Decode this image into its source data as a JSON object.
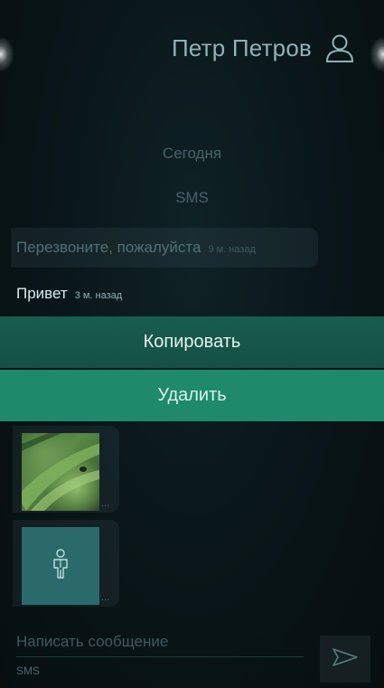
{
  "header": {
    "contact_name": "Петр Петров",
    "icon": "person-icon"
  },
  "conversation": {
    "date_label": "Сегодня",
    "channel_label": "SMS",
    "messages": [
      {
        "text": "Перезвоните, пожалуйста",
        "time": "9 м. назад",
        "direction": "incoming"
      },
      {
        "text": "Привет",
        "time": "3 м. назад",
        "direction": "outgoing"
      }
    ],
    "attachments": [
      {
        "type": "image",
        "more": "..."
      },
      {
        "type": "contact",
        "icon": "contact-card-icon",
        "more": "..."
      }
    ]
  },
  "context_menu": {
    "copy_label": "Копировать",
    "delete_label": "Удалить",
    "accent_color": "#1e8a6b"
  },
  "compose": {
    "placeholder": "Написать сообщение",
    "channel": "SMS",
    "send_icon": "send-icon"
  }
}
